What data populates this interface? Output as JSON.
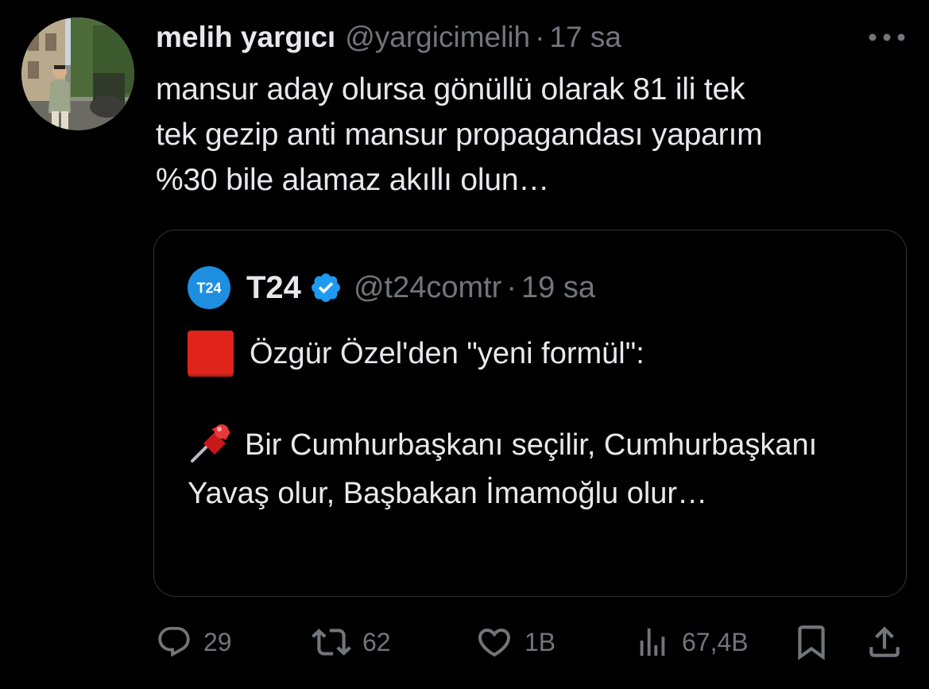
{
  "author": {
    "display_name": "melih yargıcı",
    "handle": "@yargicimelih",
    "separator": "·",
    "time": "17 sa"
  },
  "tweet": {
    "text": "mansur aday olursa gönüllü olarak 81 ili tek\ntek gezip anti mansur propagandası yaparım\n%30 bile alamaz akıllı olun…"
  },
  "quote": {
    "logo_text": "T24",
    "name": "T24",
    "handle": "@t24comtr",
    "separator": "·",
    "time": "19 sa",
    "line1": "Özgür Özel'den \"yeni formül\":",
    "body": "Bir Cumhurbaşkanı seçilir, Cumhurbaşkanı Yavaş olur, Başbakan İmamoğlu olur…"
  },
  "actions": {
    "replies": "29",
    "retweets": "62",
    "likes": "1B",
    "views": "67,4B"
  },
  "icons": {
    "more": "more-horizontal-icon",
    "verified": "verified-badge-icon",
    "reply": "reply-icon",
    "retweet": "retweet-icon",
    "like": "heart-icon",
    "views": "views-chart-icon",
    "bookmark": "bookmark-icon",
    "share": "share-icon",
    "red_square": "red-square-emoji",
    "pushpin": "pushpin-emoji"
  },
  "colors": {
    "background": "#000000",
    "text": "#e7e9ea",
    "secondary": "#71767b",
    "border": "#2f3336",
    "verified": "#1d9bf0",
    "t24_brand": "#1d8ee0",
    "red_square": "#e0241b"
  }
}
